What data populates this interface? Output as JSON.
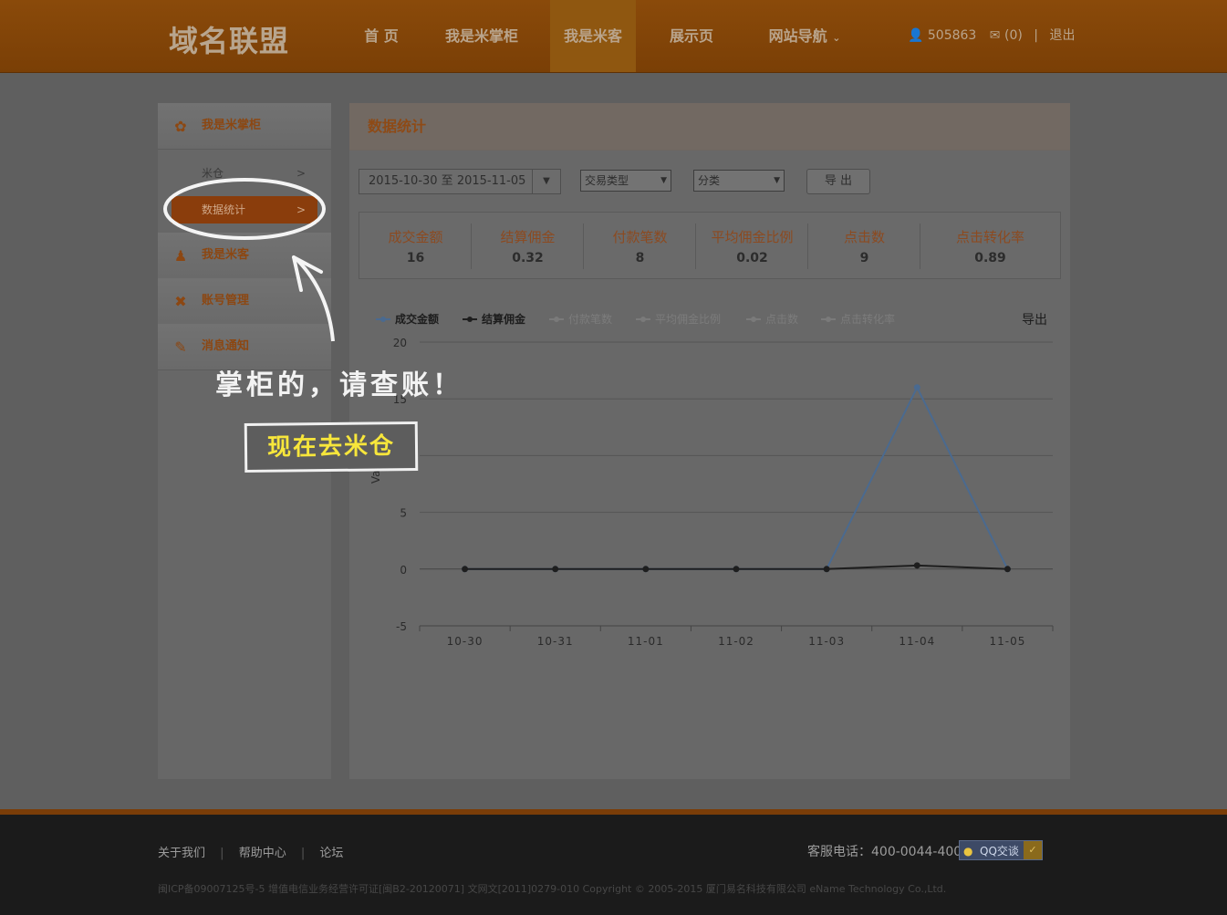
{
  "header": {
    "logo": "域名联盟",
    "nav": [
      {
        "label": "首 页"
      },
      {
        "label": "我是米掌柜"
      },
      {
        "label": "我是米客"
      },
      {
        "label": "展示页"
      },
      {
        "label": "网站导航"
      }
    ],
    "nav_dropdown_icon": "chevron-down-icon",
    "user_id": "505863",
    "messages": "(0)",
    "divider": "|",
    "logout": "退出"
  },
  "sidebar": {
    "groups": [
      {
        "label": "我是米掌柜",
        "icon": "leaf-icon"
      },
      {
        "label": "我是米客",
        "icon": "user-icon"
      },
      {
        "label": "账号管理",
        "icon": "tools-icon"
      },
      {
        "label": "消息通知",
        "icon": "chat-icon"
      }
    ],
    "sub_items": [
      {
        "label": "米仓",
        "arrow": ">"
      },
      {
        "label": "数据统计",
        "arrow": ">"
      }
    ]
  },
  "main": {
    "title": "数据统计",
    "date_range": "2015-10-30 至 2015-11-05",
    "select_trade": "交易类型",
    "select_category": "分类",
    "export": "导 出",
    "stats": [
      {
        "name": "成交金额",
        "value": "16"
      },
      {
        "name": "结算佣金",
        "value": "0.32"
      },
      {
        "name": "付款笔数",
        "value": "8"
      },
      {
        "name": "平均佣金比例",
        "value": "0.02"
      },
      {
        "name": "点击数",
        "value": "9"
      },
      {
        "name": "点击转化率",
        "value": "0.89"
      }
    ]
  },
  "chart_data": {
    "type": "line",
    "categories": [
      "10-30",
      "10-31",
      "11-01",
      "11-02",
      "11-03",
      "11-04",
      "11-05"
    ],
    "series": [
      {
        "name": "成交金额",
        "values": [
          0,
          0,
          0,
          0,
          0,
          16,
          0
        ],
        "color": "#4a6a90",
        "active": true
      },
      {
        "name": "结算佣金",
        "values": [
          0,
          0,
          0,
          0,
          0,
          0.32,
          0
        ],
        "color": "#1e1e1e",
        "active": true
      },
      {
        "name": "付款笔数",
        "values": [],
        "color": "#7c7c7c",
        "active": false
      },
      {
        "name": "平均佣金比例",
        "values": [],
        "color": "#7c7c7c",
        "active": false
      },
      {
        "name": "点击数",
        "values": [],
        "color": "#7c7c7c",
        "active": false
      },
      {
        "name": "点击转化率",
        "values": [],
        "color": "#7c7c7c",
        "active": false
      }
    ],
    "ylabel": "Values",
    "ylim": [
      -5,
      20
    ],
    "yticks": [
      -5,
      0,
      5,
      10,
      15,
      20
    ],
    "grid": true,
    "legend": "top-left",
    "export_label": "导出"
  },
  "overlay": {
    "message": "掌柜的，请查账！",
    "button": "现在去米仓"
  },
  "footer": {
    "links": [
      "关于我们",
      "帮助中心",
      "论坛"
    ],
    "separator": "|",
    "service": "客服电话：400-0044-400",
    "qq": "QQ交谈",
    "copyright": "闽ICP备09007125号-5 增值电信业务经营许可证[闽B2-20120071] 文网文[2011]0279-010 Copyright © 2005-2015 厦门易名科技有限公司 eName Technology Co.,Ltd."
  }
}
